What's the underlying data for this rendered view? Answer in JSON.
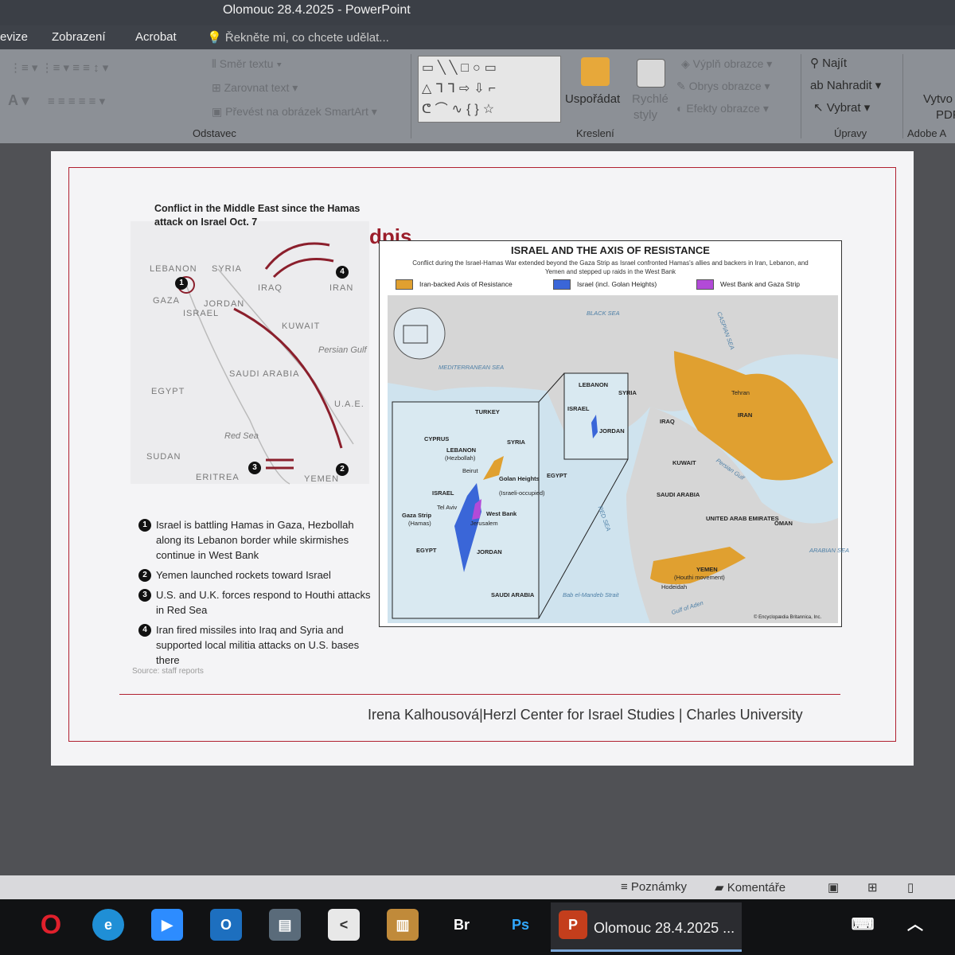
{
  "window": {
    "title": "Olomouc 28.4.2025 - PowerPoint"
  },
  "menu": {
    "tabs": [
      "evize",
      "Zobrazení",
      "Acrobat"
    ],
    "tell_me": "Řekněte mi, co chcete udělat..."
  },
  "ribbon": {
    "paragraph": {
      "text_direction": "Směr textu",
      "align_text": "Zarovnat text",
      "smartart": "Převést na obrázek SmartArt",
      "label": "Odstavec"
    },
    "drawing": {
      "arrange": "Uspořádat",
      "quick_styles_1": "Rychlé",
      "quick_styles_2": "styly",
      "shape_fill": "Výplň obrazce",
      "shape_outline": "Obrys obrazce",
      "shape_effects": "Efekty obrazce",
      "label": "Kreslení"
    },
    "editing": {
      "find": "Najít",
      "replace": "Nahradit",
      "select": "Vybrat",
      "label": "Úpravy"
    },
    "adobe": {
      "create_1": "Vytvo",
      "create_2": "PDF",
      "label": "Adobe A"
    }
  },
  "slide": {
    "left_caption": "Conflict in the Middle East since the Hamas attack on Israel Oct. 7",
    "red_title": "dpis",
    "left_map_labels": {
      "lebanon": "LEBANON",
      "syria": "SYRIA",
      "iraq": "IRAQ",
      "iran": "IRAN",
      "gaza": "GAZA",
      "jordan": "JORDAN",
      "israel": "ISRAEL",
      "kuwait": "KUWAIT",
      "persian_gulf": "Persian Gulf",
      "egypt": "EGYPT",
      "saudi": "SAUDI ARABIA",
      "uae": "U.A.E.",
      "red_sea": "Red Sea",
      "sudan": "SUDAN",
      "eritrea": "ERITREA",
      "yemen": "YEMEN"
    },
    "legend_items": [
      {
        "num": "1",
        "text": "Israel is battling Hamas in Gaza, Hezbollah along its Lebanon border while skirmishes continue in West Bank"
      },
      {
        "num": "2",
        "text": "Yemen launched rockets toward Israel"
      },
      {
        "num": "3",
        "text": "U.S. and U.K. forces respond to Houthi attacks in Red Sea"
      },
      {
        "num": "4",
        "text": "Iran fired missiles into Iraq and Syria and supported local militia attacks on U.S. bases there"
      }
    ],
    "source": "Source: staff reports",
    "axis_figure": {
      "title": "ISRAEL AND THE AXIS OF RESISTANCE",
      "subtitle": "Conflict during the Israel-Hamas War extended beyond the Gaza Strip as Israel confronted Hamas's allies and backers in Iran, Lebanon, and Yemen and stepped up raids in the West Bank",
      "legend": [
        {
          "label": "Iran-backed Axis of Resistance",
          "color": "#e0a030"
        },
        {
          "label": "Israel (incl. Golan Heights)",
          "color": "#3a66d8"
        },
        {
          "label": "West Bank and Gaza Strip",
          "color": "#b24ad8"
        }
      ],
      "labels": {
        "black_sea": "BLACK SEA",
        "caspian": "CASPIAN SEA",
        "med": "MEDITERRANEAN SEA",
        "turkey": "TURKEY",
        "cyprus": "CYPRUS",
        "lebanon": "LEBANON",
        "hezbollah": "(Hezbollah)",
        "beirut": "Beirut",
        "syria": "SYRIA",
        "golan": "Golan Heights",
        "golan_note": "(Israeli-occupied)",
        "israel": "ISRAEL",
        "tel_aviv": "Tel Aviv",
        "gaza": "Gaza Strip",
        "hamas": "(Hamas)",
        "west_bank": "West Bank",
        "jerusalem": "Jerusalem",
        "egypt": "EGYPT",
        "jordan": "JORDAN",
        "saudi": "SAUDI ARABIA",
        "inset_lebanon": "LEBANON",
        "inset_syria": "SYRIA",
        "inset_israel": "ISRAEL",
        "inset_jordan": "JORDAN",
        "egypt_main": "EGYPT",
        "iraq": "IRAQ",
        "iran": "IRAN",
        "tehran": "Tehran",
        "kuwait": "KUWAIT",
        "persian_gulf": "Persian Gulf",
        "saudi_main": "SAUDI ARABIA",
        "uae": "UNITED ARAB EMIRATES",
        "oman": "OMAN",
        "yemen": "YEMEN",
        "houthi": "(Houthi movement)",
        "hodeidah": "Hodeidah",
        "red_sea": "RED SEA",
        "arabian_sea": "ARABIAN SEA",
        "bab": "Bab el-Mandeb Strait",
        "aden": "Gulf of Aden",
        "copyright": "© Encyclopædia Britannica, Inc."
      }
    },
    "footer": "Irena Kalhousová|Herzl Center for Israel Studies | Charles University"
  },
  "status": {
    "notes": "Poznámky",
    "comments": "Komentáře"
  },
  "taskbar": {
    "active_label": "Olomouc 28.4.2025 ...",
    "apps": [
      "Opera",
      "Edge",
      "Zoom",
      "Outlook",
      "Files",
      "Share",
      "Archive",
      "Br",
      "Ps"
    ]
  }
}
